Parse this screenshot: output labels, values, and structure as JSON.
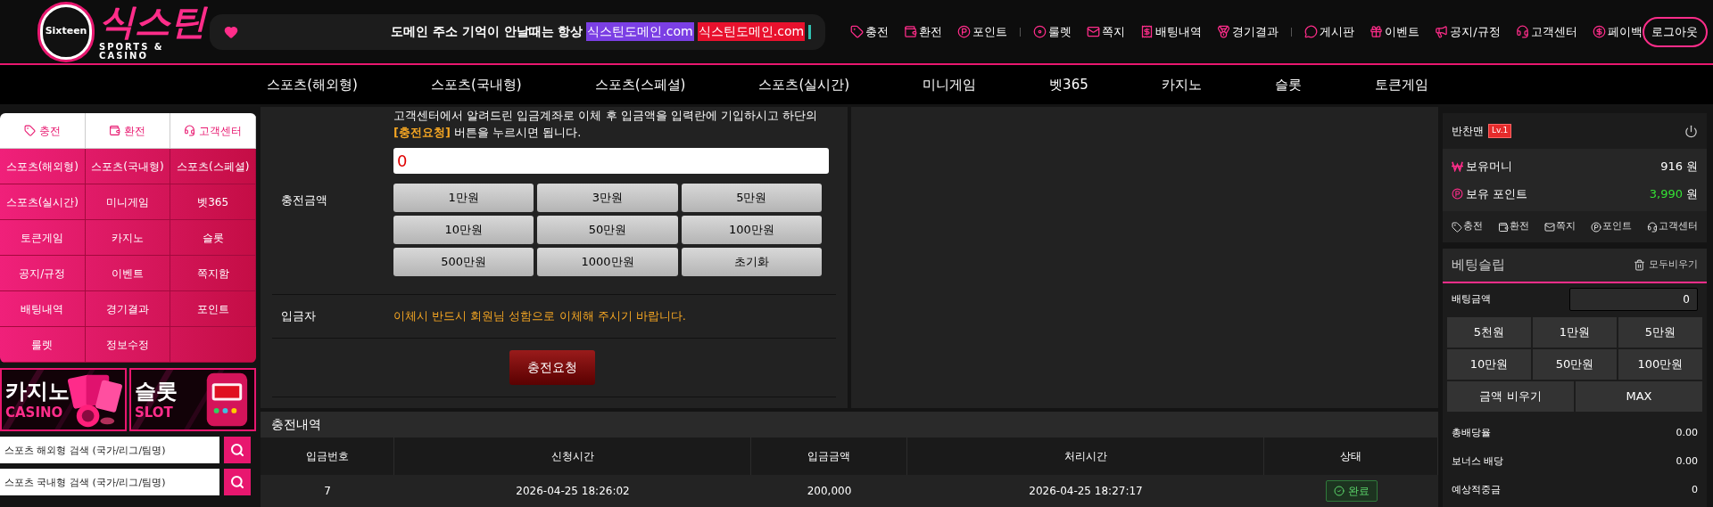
{
  "logo": {
    "badge": "Sixteen",
    "title": "식스틴",
    "subtitle": "SPORTS & CASINO"
  },
  "notice": {
    "text": "도메인 주소 기억이 안날때는 항상",
    "highlights": [
      {
        "text": "식스틴도메인.com",
        "color": "#7b3fe4"
      },
      {
        "text": "식스틴도메인.com",
        "color": "#e8112d"
      }
    ]
  },
  "header_links": [
    {
      "items": [
        "충전",
        "환전",
        "포인트"
      ]
    },
    {
      "items": [
        "룰렛",
        "쪽지",
        "배팅내역",
        "경기결과"
      ]
    },
    {
      "items": [
        "게시판",
        "이벤트",
        "공지/규정",
        "고객센터",
        "페이백"
      ]
    }
  ],
  "logout_button": "로그아웃",
  "nav": [
    "스포츠(해외형)",
    "스포츠(국내형)",
    "스포츠(스페셜)",
    "스포츠(실시간)",
    "미니게임",
    "벳365",
    "카지노",
    "슬롯",
    "토큰게임"
  ],
  "sidebar": {
    "tabs": [
      "충전",
      "환전",
      "고객센터"
    ],
    "menu": [
      "스포츠(해외형)",
      "스포츠(국내형)",
      "스포츠(스페셜)",
      "스포츠(실시간)",
      "미니게임",
      "벳365",
      "토큰게임",
      "카지노",
      "슬롯",
      "공지/규정",
      "이벤트",
      "쪽지함",
      "배팅내역",
      "경기결과",
      "포인트",
      "룰렛",
      "정보수정"
    ],
    "banners": [
      {
        "title": "카지노",
        "subtitle": "CASINO"
      },
      {
        "title": "슬롯",
        "subtitle": "SLOT"
      }
    ],
    "searches": [
      {
        "placeholder": "스포츠 해외형 검색 (국가/리그/팀명)"
      },
      {
        "placeholder": "스포츠 국내형 검색 (국가/리그/팀명)"
      }
    ]
  },
  "form": {
    "intro": "고객센터에서 알려드린 입금계좌로 이체 후 입금액을 입력란에 기입하시고 하단의 **[충전요청]** 버튼을 누르시면 됩니다.",
    "amount_label": "충전금액",
    "amount_value": "0",
    "amount_buttons": [
      "1만원",
      "3만원",
      "5만원",
      "10만원",
      "50만원",
      "100만원",
      "500만원",
      "1000만원",
      "초기화"
    ],
    "depositor_label": "입금자",
    "depositor_note": "이체시 반드시 회원님 성함으로 이체해 주시기 바랍니다.",
    "submit": "충전요청"
  },
  "history": {
    "title": "충전내역",
    "columns": [
      "입금번호",
      "신청시간",
      "입금금액",
      "처리시간",
      "상태"
    ],
    "rows": [
      {
        "cells": [
          "7",
          "2026-04-25 18:26:02",
          "200,000",
          "2026-04-25 18:27:17"
        ],
        "status": {
          "text": "완료",
          "kind": "done"
        }
      }
    ]
  },
  "account": {
    "name": "반찬맨",
    "level": "Lv.1",
    "balances": [
      {
        "label": "보유머니",
        "value": "916",
        "unit": "원",
        "kind": "money"
      },
      {
        "label": "보유 포인트",
        "value": "3,990",
        "unit": "원",
        "kind": "point"
      }
    ],
    "links": [
      "충전",
      "환전",
      "쪽지",
      "포인트",
      "고객센터"
    ]
  },
  "bet_slip": {
    "title": "베팅슬립",
    "clear_all": "모두비우기",
    "amount_label": "배팅금액",
    "amount_value": "0",
    "quick_buttons": [
      "5천원",
      "1만원",
      "5만원",
      "10만원",
      "50만원",
      "100만원"
    ],
    "wide_buttons": [
      "금액 비우기",
      "MAX"
    ],
    "stats": [
      {
        "label": "총배당율",
        "value": "0.00"
      },
      {
        "label": "보너스 배당",
        "value": "0.00"
      },
      {
        "label": "예상적중금",
        "value": "0"
      }
    ]
  }
}
